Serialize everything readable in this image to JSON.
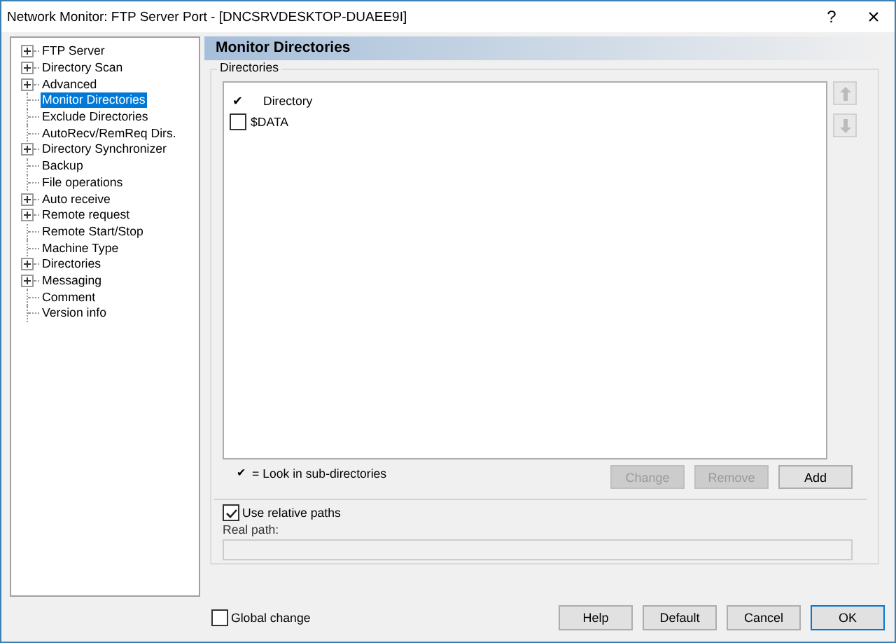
{
  "window": {
    "title": "Network Monitor: FTP Server Port - [DNCSRVDESKTOP-DUAEE9I]",
    "help": "?",
    "close": "×"
  },
  "tree": [
    {
      "label": "FTP Server",
      "expandable": true,
      "selected": false
    },
    {
      "label": "Directory Scan",
      "expandable": true,
      "selected": false
    },
    {
      "label": "Advanced",
      "expandable": true,
      "selected": false
    },
    {
      "label": "Monitor Directories",
      "expandable": false,
      "selected": true
    },
    {
      "label": "Exclude Directories",
      "expandable": false,
      "selected": false
    },
    {
      "label": "AutoRecv/RemReq Dirs.",
      "expandable": false,
      "selected": false
    },
    {
      "label": "Directory Synchronizer",
      "expandable": true,
      "selected": false
    },
    {
      "label": "Backup",
      "expandable": false,
      "selected": false
    },
    {
      "label": "File operations",
      "expandable": false,
      "selected": false
    },
    {
      "label": "Auto receive",
      "expandable": true,
      "selected": false
    },
    {
      "label": "Remote request",
      "expandable": true,
      "selected": false
    },
    {
      "label": "Remote Start/Stop",
      "expandable": false,
      "selected": false
    },
    {
      "label": "Machine Type",
      "expandable": false,
      "selected": false
    },
    {
      "label": "Directories",
      "expandable": true,
      "selected": false
    },
    {
      "label": "Messaging",
      "expandable": true,
      "selected": false
    },
    {
      "label": "Comment",
      "expandable": false,
      "selected": false
    },
    {
      "label": "Version info",
      "expandable": false,
      "selected": false
    }
  ],
  "panel": {
    "title": "Monitor Directories",
    "group": "Directories",
    "columns": [
      "✔",
      "Directory"
    ],
    "rows": [
      {
        "name": "$DATA",
        "checked": false
      }
    ],
    "legend_mark": "✔",
    "legend": "= Look in sub-directories",
    "buttons": [
      {
        "label": "Change",
        "disabled": true
      },
      {
        "label": "Remove",
        "disabled": true
      },
      {
        "label": "Add",
        "disabled": false
      }
    ],
    "relative": {
      "label": "Use relative paths",
      "checked": true
    },
    "real_path": {
      "label": "Real path:"
    }
  },
  "global_change": {
    "label": "Global change",
    "checked": false
  },
  "footer_buttons": [
    {
      "label": "Help",
      "default": false
    },
    {
      "label": "Default",
      "default": false
    },
    {
      "label": "Cancel",
      "default": false
    },
    {
      "label": "OK",
      "default": true
    }
  ]
}
